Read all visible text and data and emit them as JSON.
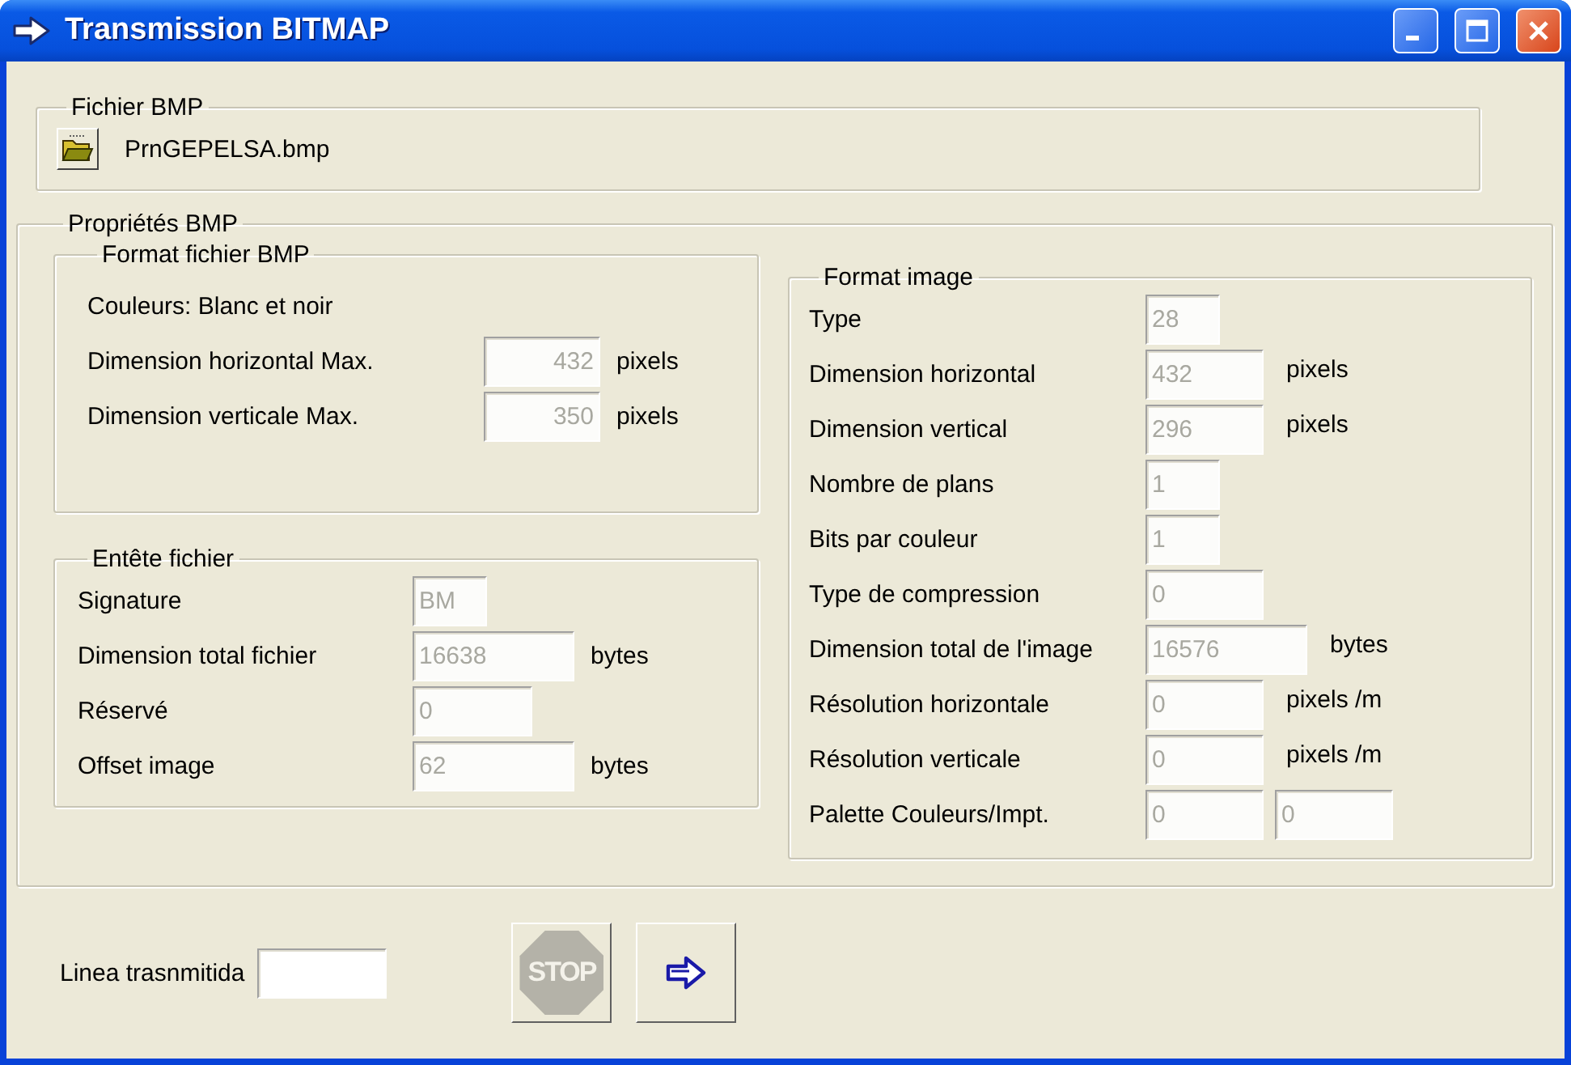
{
  "window": {
    "title": "Transmission BITMAP"
  },
  "file_group": {
    "title": "Fichier BMP",
    "file_name": "PrnGEPELSA.bmp"
  },
  "properties_group": {
    "title": "Propriétés BMP",
    "format_file": {
      "title": "Format fichier BMP",
      "colors_text": "Couleurs: Blanc et noir",
      "rows": [
        {
          "label": "Dimension horizontal Max.",
          "value": "432",
          "unit": "pixels",
          "disabled": true
        },
        {
          "label": "Dimension verticale Max.",
          "value": "350",
          "unit": "pixels",
          "disabled": true
        }
      ]
    },
    "file_header": {
      "title": "Entête fichier",
      "rows": [
        {
          "label": "Signature",
          "value": "BM",
          "disabled": true
        },
        {
          "label": "Dimension total fichier",
          "value": "16638",
          "unit": "bytes",
          "disabled": true
        },
        {
          "label": "Réservé",
          "value": "0",
          "disabled": true
        },
        {
          "label": "Offset image",
          "value": "62",
          "unit": "bytes",
          "disabled": true
        }
      ]
    },
    "image_format": {
      "title": "Format image",
      "rows": [
        {
          "label": "Type",
          "value": "28",
          "disabled": true
        },
        {
          "label": "Dimension horizontal",
          "value": "432",
          "unit": "pixels",
          "disabled": true
        },
        {
          "label": "Dimension vertical",
          "value": "296",
          "unit": "pixels",
          "disabled": true
        },
        {
          "label": "Nombre de plans",
          "value": "1",
          "disabled": true
        },
        {
          "label": "Bits par couleur",
          "value": "1",
          "disabled": true
        },
        {
          "label": "Type de compression",
          "value": "0",
          "disabled": true
        },
        {
          "label": "Dimension total de l'image",
          "value": "16576",
          "unit": "bytes",
          "disabled": true
        },
        {
          "label": "Résolution horizontale",
          "value": "0",
          "unit": "pixels /m",
          "disabled": true
        },
        {
          "label": "Résolution verticale",
          "value": "0",
          "unit": "pixels /m",
          "disabled": true
        },
        {
          "label": "Palette Couleurs/Impt.",
          "value": "0",
          "value_2": "0",
          "disabled": true
        }
      ]
    }
  },
  "transmitted_line": {
    "label": "Linea trasnmitida"
  },
  "buttons": [
    {
      "kind": "stop",
      "label": "STOP",
      "disabled": true
    },
    {
      "kind": "send",
      "disabled": false
    }
  ]
}
